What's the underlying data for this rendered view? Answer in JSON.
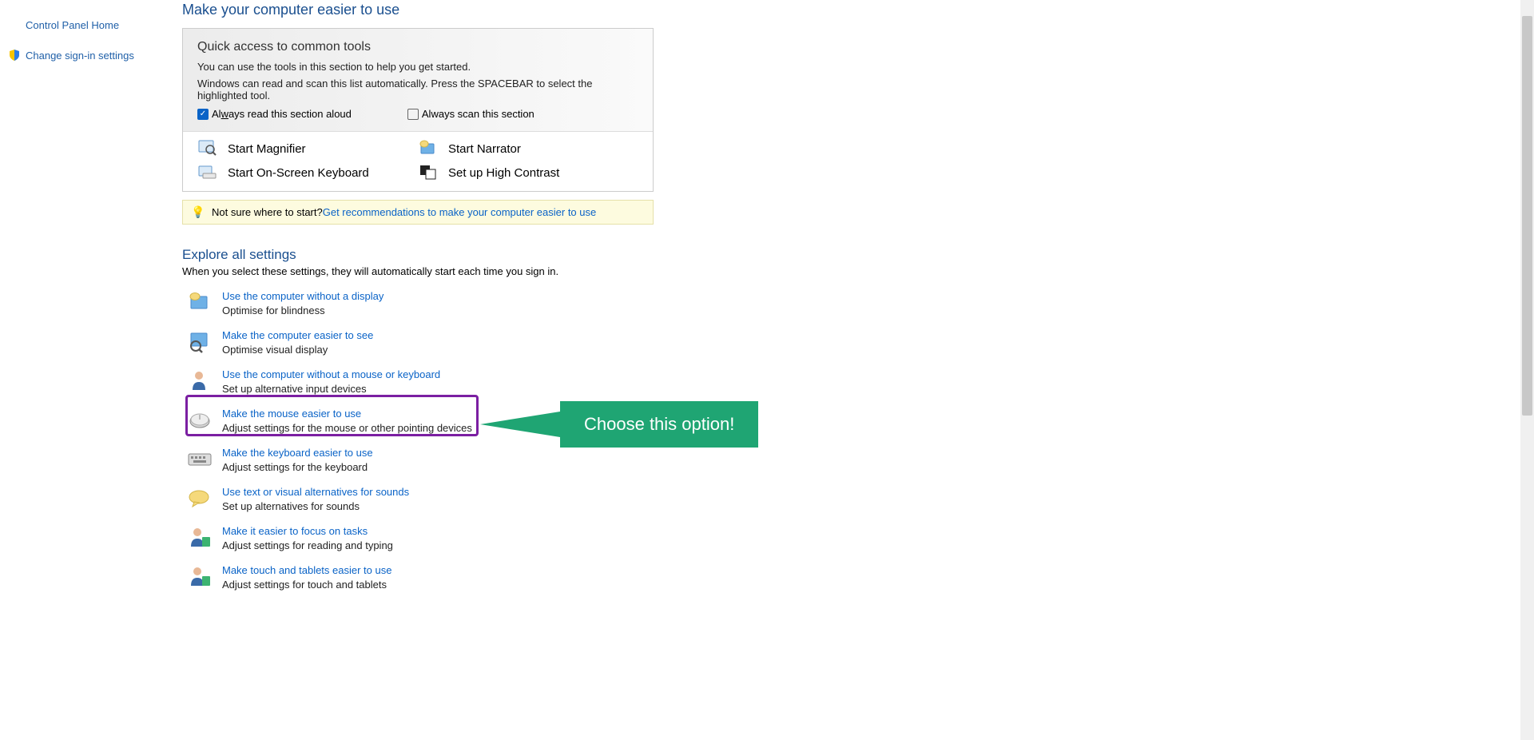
{
  "sidebar": {
    "home": "Control Panel Home",
    "signin": "Change sign-in settings"
  },
  "page_title": "Make your computer easier to use",
  "quick": {
    "title": "Quick access to common tools",
    "line1": "You can use the tools in this section to help you get started.",
    "line2": "Windows can read and scan this list automatically.  Press the SPACEBAR to select the highlighted tool.",
    "cb1_pre": "Al",
    "cb1_ul": "w",
    "cb1_post": "ays read this section aloud",
    "cb2": "Always scan this section",
    "tool_magnifier": "Start Magnifier",
    "tool_narrator": "Start Narrator",
    "tool_osk": "Start On-Screen Keyboard",
    "tool_contrast": "Set up High Contrast"
  },
  "tip": {
    "prefix": "Not sure where to start? ",
    "link": "Get recommendations to make your computer easier to use"
  },
  "explore": {
    "title": "Explore all settings",
    "sub": "When you select these settings, they will automatically start each time you sign in."
  },
  "settings": [
    {
      "title": "Use the computer without a display",
      "desc": "Optimise for blindness"
    },
    {
      "title": "Make the computer easier to see",
      "desc": "Optimise visual display"
    },
    {
      "title": "Use the computer without a mouse or keyboard",
      "desc": "Set up alternative input devices"
    },
    {
      "title": "Make the mouse easier to use",
      "desc": "Adjust settings for the mouse or other pointing devices"
    },
    {
      "title": "Make the keyboard easier to use",
      "desc": "Adjust settings for the keyboard"
    },
    {
      "title": "Use text or visual alternatives for sounds",
      "desc": "Set up alternatives for sounds"
    },
    {
      "title": "Make it easier to focus on tasks",
      "desc": "Adjust settings for reading and typing"
    },
    {
      "title": "Make touch and tablets easier to use",
      "desc": "Adjust settings for touch and tablets"
    }
  ],
  "callout": "Choose this option!"
}
